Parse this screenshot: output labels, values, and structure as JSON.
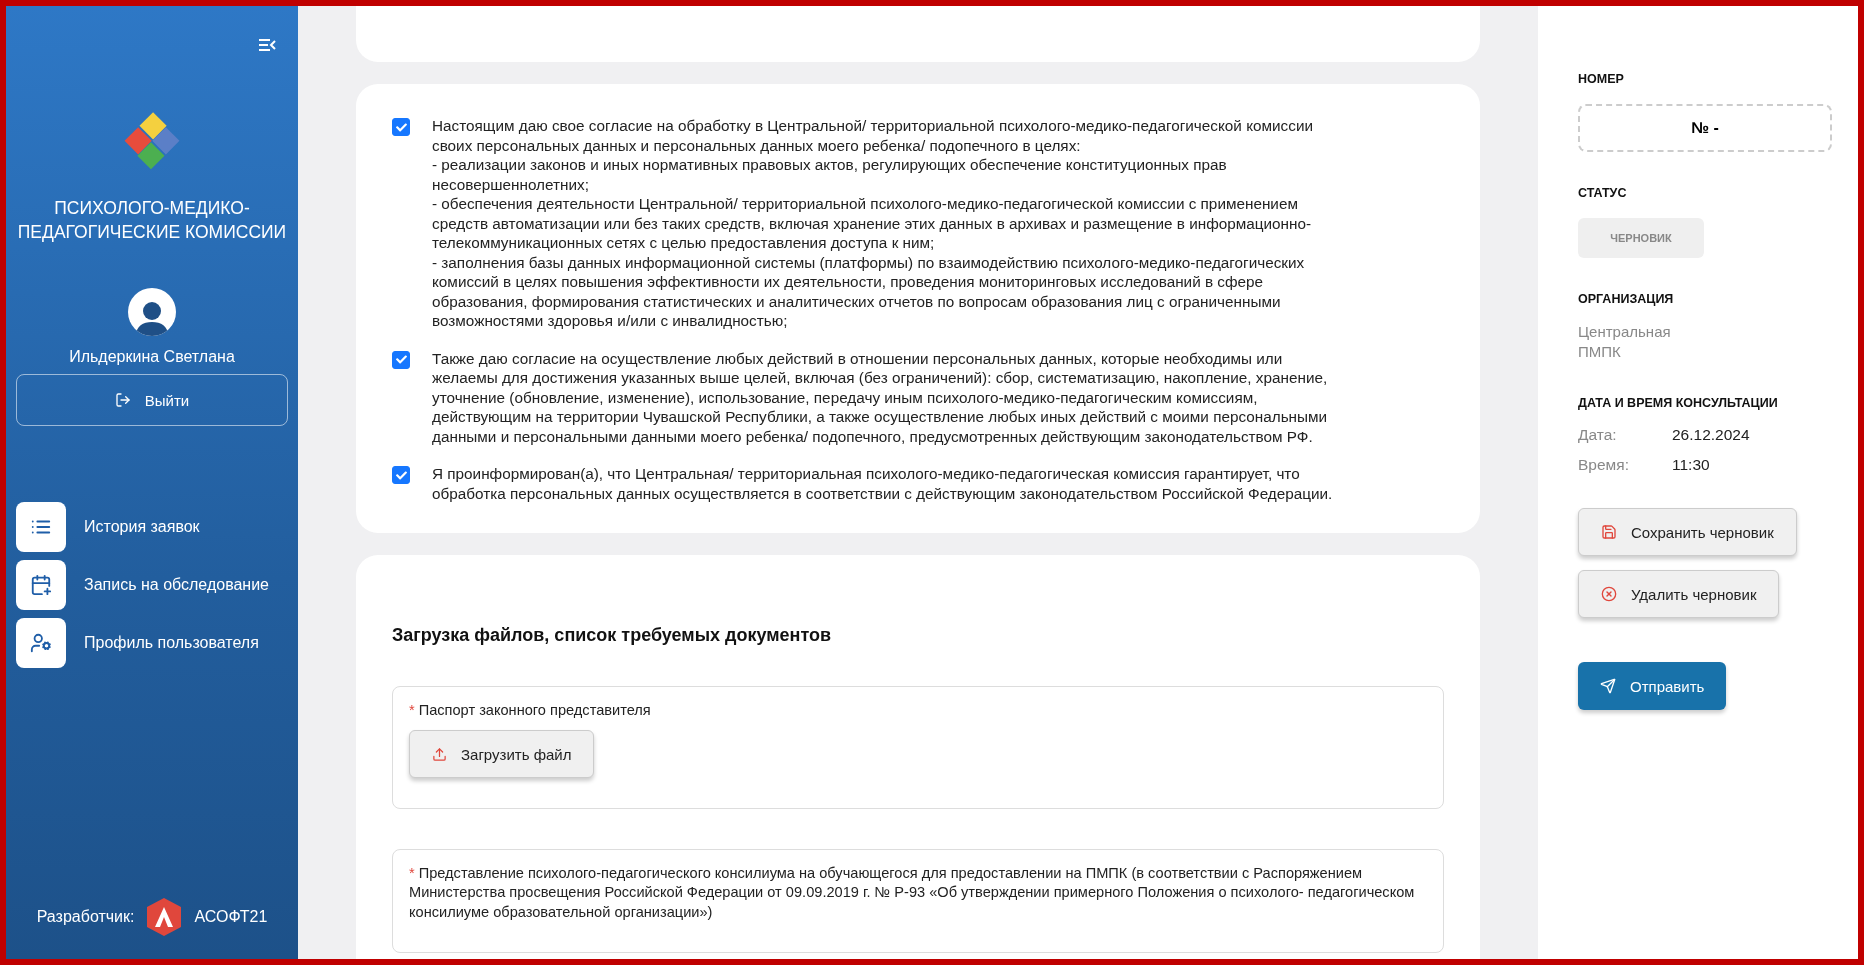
{
  "sidebar": {
    "title": "ПСИХОЛОГО-МЕДИКО-ПЕДАГОГИЧЕСКИЕ КОМИССИИ",
    "user_name": "Ильдеркина Светлана",
    "logout_button": "Выйти",
    "nav": [
      {
        "label": "История заявок",
        "kind": "list"
      },
      {
        "label": "Запись на обследование",
        "kind": "calendar"
      },
      {
        "label": "Профиль пользователя",
        "kind": "profile"
      }
    ],
    "developer_label": "Разработчик:",
    "developer_name": "АСОФТ21"
  },
  "consents": [
    {
      "checked": true,
      "text": "Настоящим даю свое согласие на обработку в Центральной/ территориальной психолого-медико-педагогической комиссии своих персональных данных и персональных данных моего ребенка/ подопечного в целях:\n- реализации законов и иных нормативных правовых актов, регулирующих обеспечение конституционных прав несовершеннолетних;\n- обеспечения деятельности Центральной/ территориальной психолого-медико-педагогической комиссии с применением средств автоматизации или без таких средств, включая хранение этих данных в архивах и размещение в информационно-телекоммуникационных сетях с целью предоставления доступа к ним;\n- заполнения базы данных информационной системы (платформы) по взаимодействию психолого-медико-педагогических комиссий в целях повышения эффективности их деятельности, проведения мониторинговых исследований в сфере образования, формирования статистических и аналитических отчетов по вопросам образования лиц с ограниченными возможностями здоровья и/или с инвалидностью;"
    },
    {
      "checked": true,
      "text": "Также даю согласие на осуществление любых действий в отношении персональных данных, которые необходимы или желаемы для достижения указанных выше целей, включая (без ограничений): сбор, систематизацию, накопление, хранение, уточнение (обновление, изменение), использование, передачу иным психолого-медико-педагогическим комиссиям, действующим на территории Чувашской Республики, а также осуществление любых иных действий с моими персональными данными и персональными данными моего ребенка/ подопечного, предусмотренных действующим законодательством РФ."
    },
    {
      "checked": true,
      "text": "Я проинформирован(а), что Центральная/ территориальная психолого-медико-педагогическая комиссия гарантирует, что обработка персональных данных осуществляется в соответствии с действующим законодательством Российской Федерации."
    }
  ],
  "uploads": {
    "title": "Загрузка файлов, список требуемых документов",
    "items": [
      {
        "marker": "*",
        "label": "Паспорт законного представителя",
        "button": "Загрузить файл"
      },
      {
        "marker": "*",
        "label": "Представление психолого-педагогического консилиума на обучающегося для предоставлении на ПМПК (в соответствии с Распоряжением Министерства просвещения Российской Федерации от 09.09.2019 г. № Р-93 «Об утверждении примерного Положения о психолого- педагогическом консилиуме образовательной организации»)"
      }
    ]
  },
  "info": {
    "number_label": "НОМЕР",
    "number": "№ -",
    "status_label": "СТАТУС",
    "status": "ЧЕРНОВИК",
    "org_label": "ОРГАНИЗАЦИЯ",
    "org": "Центральная\nПМПК",
    "datetime_label": "ДАТА И ВРЕМЯ КОНСУЛЬТАЦИИ",
    "date_label": "Дата:",
    "date": "26.12.2024",
    "time_label": "Время:",
    "time": "11:30",
    "actions": [
      {
        "label": "Сохранить черновик",
        "kind": "save"
      },
      {
        "label": "Удалить черновик",
        "kind": "delete"
      },
      {
        "label": "Отправить",
        "kind": "send"
      }
    ]
  }
}
